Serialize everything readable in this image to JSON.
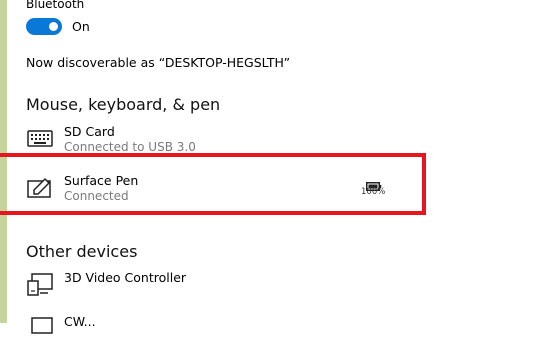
{
  "bluetooth": {
    "label": "Bluetooth",
    "toggle_state": "On",
    "discoverable_text": "Now discoverable as “DESKTOP-HEGSLTH”"
  },
  "sections": {
    "mouse_keyboard_pen": {
      "title": "Mouse, keyboard, & pen",
      "devices": [
        {
          "name": "SD Card",
          "status": "Connected to USB 3.0",
          "icon": "keyboard-icon"
        },
        {
          "name": "Surface Pen",
          "status": "Connected",
          "icon": "pen-icon",
          "battery": "100%"
        }
      ]
    },
    "other_devices": {
      "title": "Other devices",
      "devices": [
        {
          "name": "3D Video Controller",
          "icon": "device-icon"
        },
        {
          "name": "CW...",
          "icon": "device-icon"
        }
      ]
    }
  },
  "colors": {
    "accent": "#0a78d7",
    "highlight_box": "#e8141e",
    "side_strip": "#c4d49c"
  }
}
